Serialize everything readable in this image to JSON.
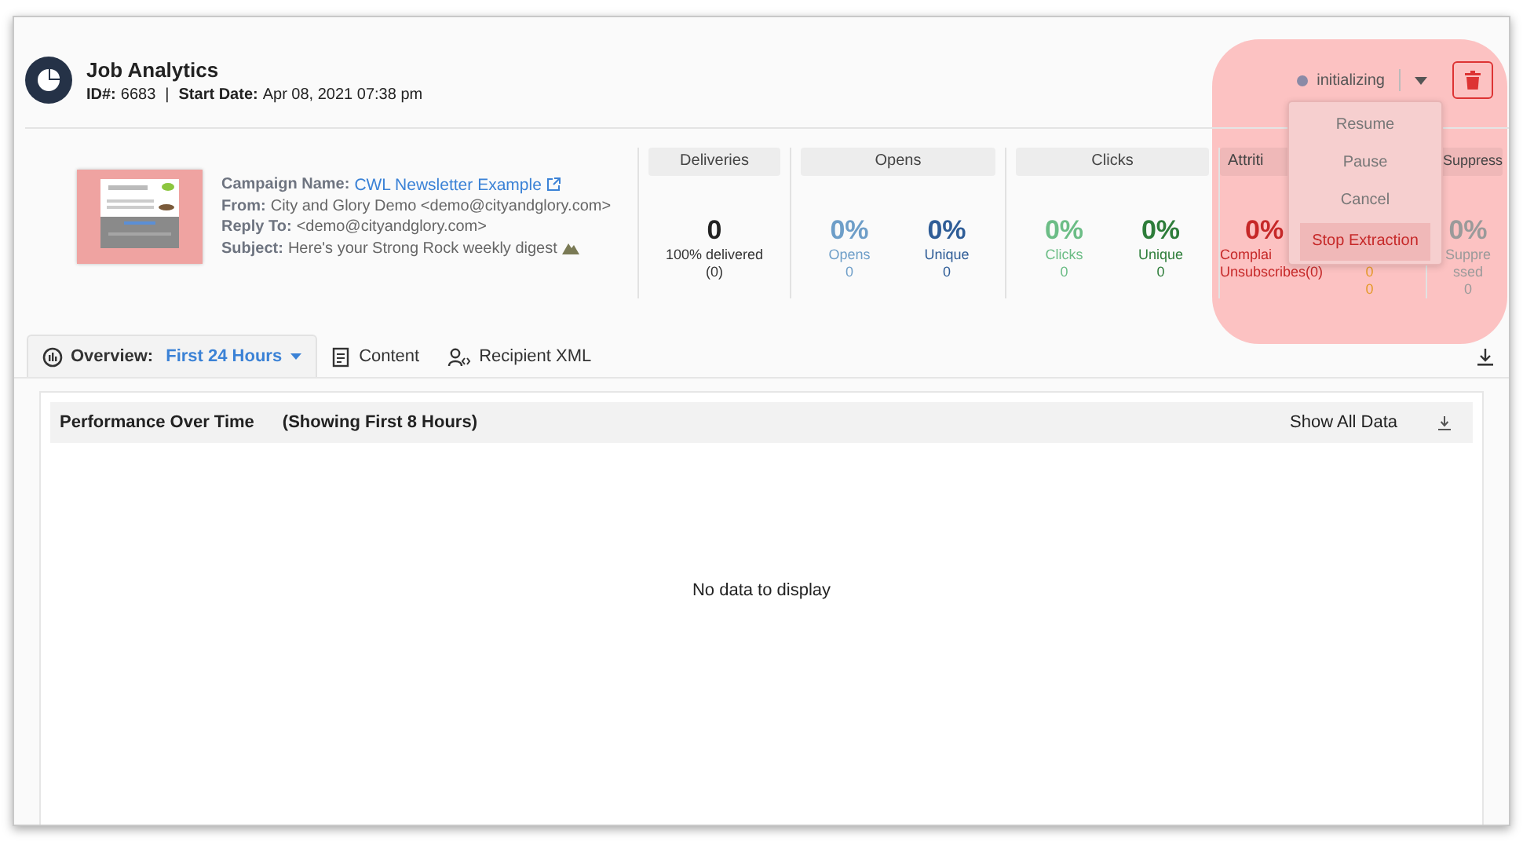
{
  "job": {
    "title": "Job Analytics",
    "id_label": "ID#:",
    "id": "6683",
    "separator": "|",
    "start_label": "Start Date:",
    "start_date": "Apr 08, 2021 07:38 pm"
  },
  "status": {
    "label": "initializing"
  },
  "menu": {
    "items": [
      {
        "label": "Resume",
        "selected": false
      },
      {
        "label": "Pause",
        "selected": false
      },
      {
        "label": "Cancel",
        "selected": false
      },
      {
        "label": "Stop Extraction",
        "selected": true
      }
    ]
  },
  "campaign": {
    "fields": [
      {
        "label": "Campaign Name:",
        "value": "CWL Newsletter Example",
        "kind": "link"
      },
      {
        "label": "From:",
        "value": "City and Glory Demo <demo@cityandglory.com>",
        "kind": "text"
      },
      {
        "label": "Reply To:",
        "value": "<demo@cityandglory.com>",
        "kind": "text"
      },
      {
        "label": "Subject:",
        "value": "Here's your Strong Rock weekly digest",
        "kind": "subject"
      }
    ]
  },
  "stats": [
    {
      "title": "Deliveries",
      "metrics": [
        {
          "kind": "big",
          "value": "0",
          "label": "100% delivered",
          "count": "(0)"
        }
      ]
    },
    {
      "title": "Opens",
      "metrics": [
        {
          "kind": "rate",
          "value": "0%",
          "label": "Opens",
          "count": "0",
          "color": "#6e9ec8"
        },
        {
          "kind": "rate",
          "value": "0%",
          "label": "Unique",
          "count": "0",
          "color": "#2f5d97"
        }
      ]
    },
    {
      "title": "Clicks",
      "metrics": [
        {
          "kind": "rate",
          "value": "0%",
          "label": "Clicks",
          "count": "0",
          "color": "#6cbd86"
        },
        {
          "kind": "rate",
          "value": "0%",
          "label": "Unique",
          "count": "0",
          "color": "#2e7d3a"
        }
      ]
    },
    {
      "title": "Attriti",
      "metrics": [
        {
          "kind": "cut",
          "value": "0%",
          "label": "Complai",
          "count": "Unsubscribes(0)",
          "color": "#c62828"
        },
        {
          "kind": "partial",
          "label": "0",
          "count": "0",
          "color": "#e59a2b"
        }
      ]
    },
    {
      "title": "Suppress",
      "metrics": [
        {
          "kind": "rate",
          "value": "0%",
          "label": "Suppressed",
          "count": "0",
          "color": "#9a9a9a"
        }
      ]
    }
  ],
  "tabs": [
    {
      "label": "Overview:",
      "value": "First 24 Hours",
      "selected": true,
      "kind": "dropdown"
    },
    {
      "label": "Content",
      "selected": false,
      "kind": "content"
    },
    {
      "label": "Recipient XML",
      "selected": false,
      "kind": "xml"
    }
  ],
  "panel": {
    "title": "Performance Over Time",
    "subtitle": "(Showing First 8 Hours)",
    "action": "Show All Data",
    "empty": "No data to display"
  }
}
